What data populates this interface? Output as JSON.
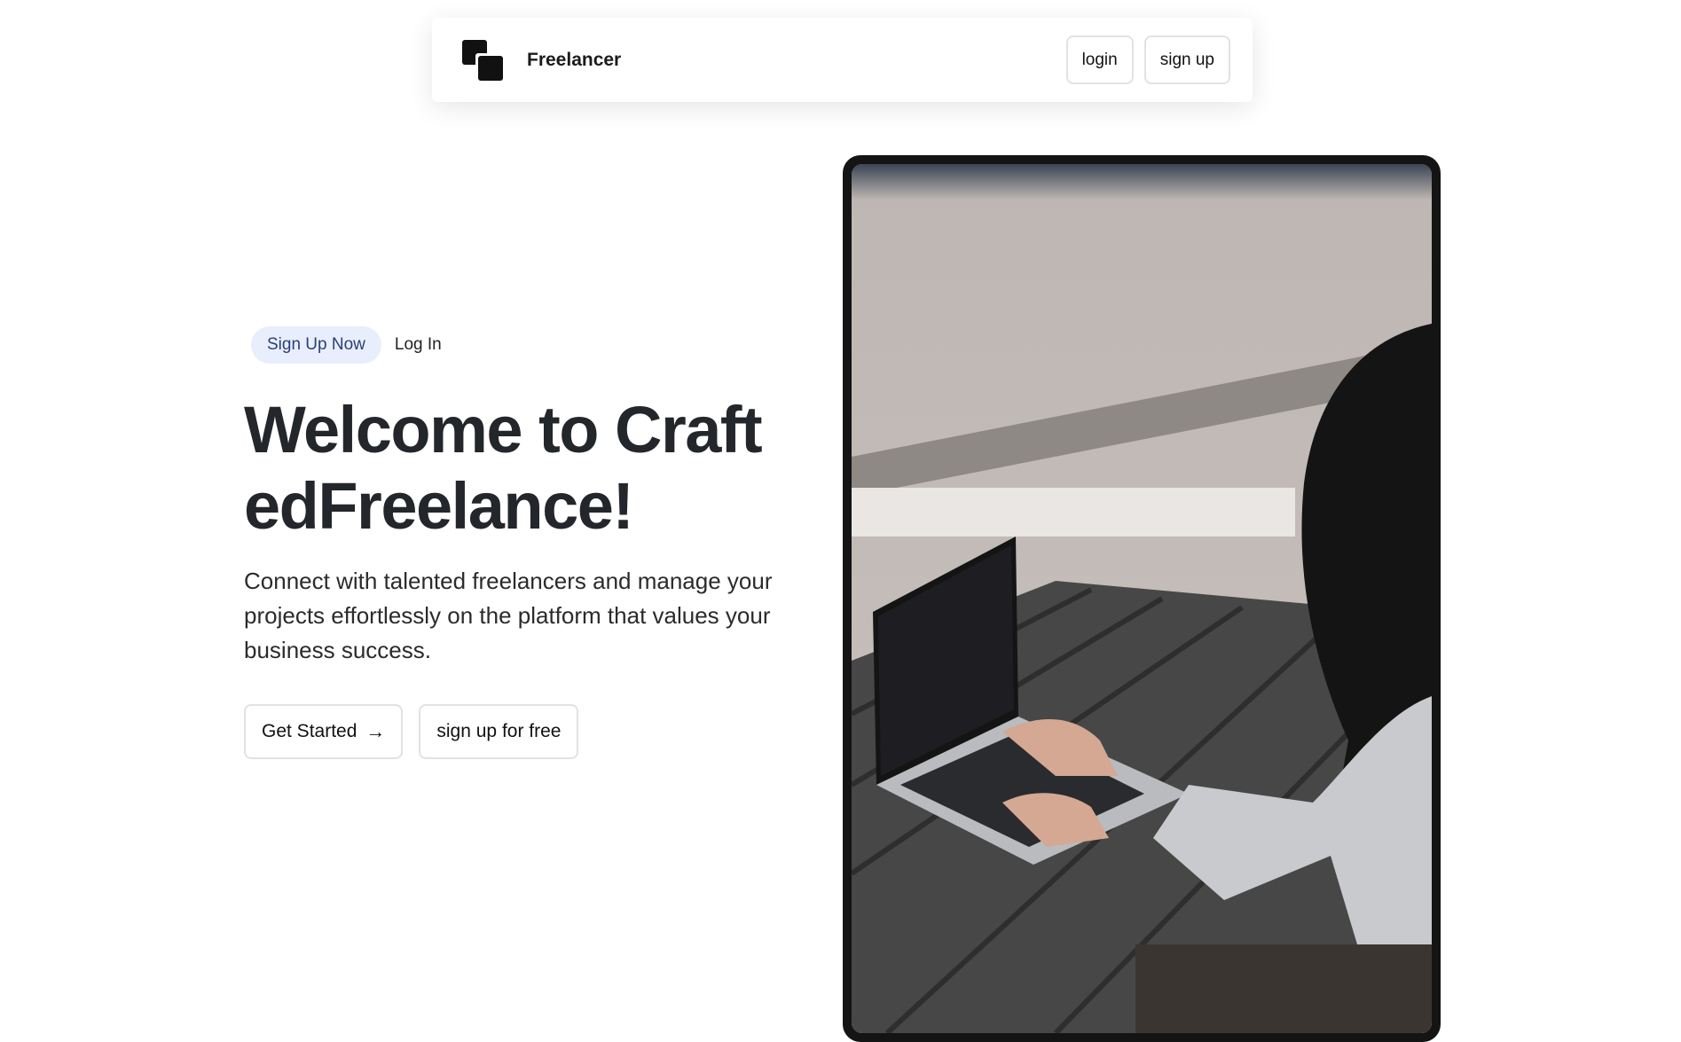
{
  "nav": {
    "brand": "Freelancer",
    "login_label": "login",
    "signup_label": "sign up"
  },
  "hero": {
    "pill_label": "Sign Up Now",
    "login_link": "Log In",
    "headline": "Welcome to CraftedFreelance!",
    "description": "Connect with talented freelancers and manage your projects effortlessly on the platform that values your business success.",
    "primary_cta": "Get Started",
    "primary_cta_icon": "arrow-right-icon",
    "secondary_cta": "sign up for free"
  },
  "colors": {
    "pill_bg": "#e8eefb",
    "pill_text": "#2a3f7a",
    "frame": "#141414"
  }
}
